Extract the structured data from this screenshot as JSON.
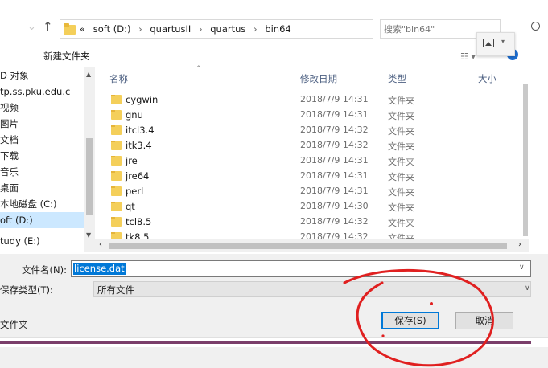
{
  "address_bar": {
    "overflow": "«",
    "crumbs": [
      "soft (D:)",
      "quartusII",
      "quartus",
      "bin64"
    ],
    "separator": "›",
    "search_placeholder": "搜索\"bin64\""
  },
  "toolbar": {
    "new_folder_label": "新建文件夹"
  },
  "nav_pane": {
    "items": [
      {
        "label": "D 对象",
        "selected": false
      },
      {
        "label": "tp.ss.pku.edu.c",
        "selected": false
      },
      {
        "label": "视频",
        "selected": false
      },
      {
        "label": "图片",
        "selected": false
      },
      {
        "label": "文档",
        "selected": false
      },
      {
        "label": "下载",
        "selected": false
      },
      {
        "label": "音乐",
        "selected": false
      },
      {
        "label": "桌面",
        "selected": false
      },
      {
        "label": "本地磁盘 (C:)",
        "selected": false
      },
      {
        "label": "oft (D:)",
        "selected": true
      },
      {
        "label": "tudy (E:)",
        "selected": false
      }
    ]
  },
  "columns": {
    "name": "名称",
    "date": "修改日期",
    "type": "类型",
    "size": "大小"
  },
  "files": [
    {
      "name": "cygwin",
      "date": "2018/7/9 14:31",
      "type": "文件夹"
    },
    {
      "name": "gnu",
      "date": "2018/7/9 14:31",
      "type": "文件夹"
    },
    {
      "name": "itcl3.4",
      "date": "2018/7/9 14:32",
      "type": "文件夹"
    },
    {
      "name": "itk3.4",
      "date": "2018/7/9 14:32",
      "type": "文件夹"
    },
    {
      "name": "jre",
      "date": "2018/7/9 14:31",
      "type": "文件夹"
    },
    {
      "name": "jre64",
      "date": "2018/7/9 14:31",
      "type": "文件夹"
    },
    {
      "name": "perl",
      "date": "2018/7/9 14:31",
      "type": "文件夹"
    },
    {
      "name": "qt",
      "date": "2018/7/9 14:30",
      "type": "文件夹"
    },
    {
      "name": "tcl8.5",
      "date": "2018/7/9 14:32",
      "type": "文件夹"
    },
    {
      "name": "tk8.5",
      "date": "2018/7/9 14:32",
      "type": "文件夹"
    }
  ],
  "save_form": {
    "filename_label": "文件名(N):",
    "filename_value": "license.dat",
    "savetype_label": "保存类型(T):",
    "savetype_value": "所有文件",
    "folder_toggle_label": "文件夹",
    "save_button": "保存(S)",
    "cancel_button": "取消"
  },
  "colors": {
    "selection": "#0078d7",
    "nav_selected": "#cce8ff",
    "folder": "#f4cf5a",
    "annotation": "#e02020"
  }
}
